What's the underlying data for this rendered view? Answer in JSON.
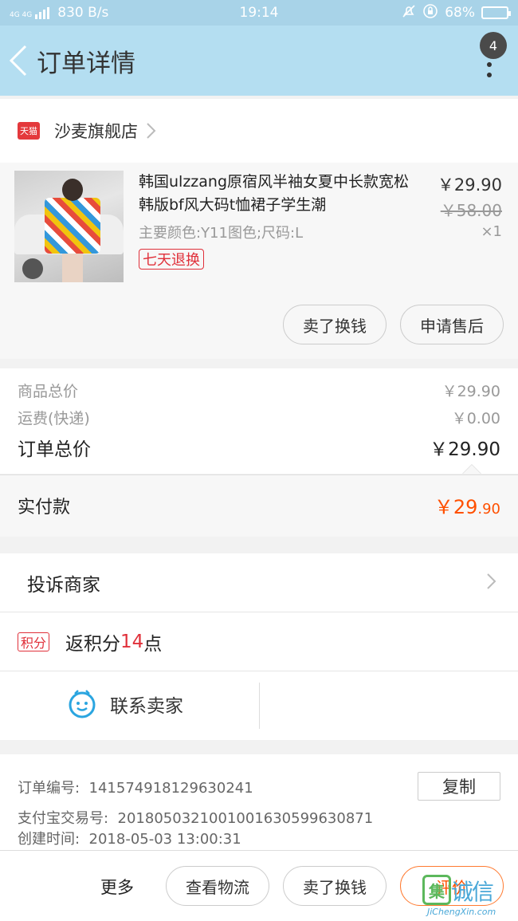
{
  "status_bar": {
    "network": "4G 4G",
    "speed": "830 B/s",
    "time": "19:14",
    "battery": "68%",
    "battery_fraction": 0.68
  },
  "nav": {
    "title": "订单详情",
    "badge": "4"
  },
  "shop": {
    "name": "沙麦旗舰店",
    "logo_text": "天猫"
  },
  "product": {
    "title": "韩国ulzzang原宿风半袖女夏中长款宽松韩版bf风大码t恤裙子学生潮",
    "spec": "主要颜色:Y11图色;尺码:L",
    "return_tag": "七天退换",
    "price": "￥29.90",
    "original_price": "￥58.00",
    "quantity": "×1",
    "buttons": {
      "sell": "卖了换钱",
      "after_sale": "申请售后"
    }
  },
  "totals": {
    "goods_label": "商品总价",
    "goods_value": "￥29.90",
    "shipping_label": "运费(快递)",
    "shipping_value": "￥0.00",
    "order_label": "订单总价",
    "order_value": "￥29.90"
  },
  "paid": {
    "label": "实付款",
    "currency": "￥",
    "int": "29",
    "dec": ".90"
  },
  "complain": {
    "label": "投诉商家"
  },
  "points": {
    "tag": "积分",
    "prefix": "返积分",
    "num": "14",
    "suffix": "点"
  },
  "contact": {
    "label": "联系卖家"
  },
  "order_info": {
    "order_no_label": "订单编号:",
    "order_no": "141574918129630241",
    "alipay_label": "支付宝交易号:",
    "alipay_no": "2018050321001001630599630871",
    "created_label": "创建时间:",
    "created": "2018-05-03 13:00:31",
    "copy_label": "复制"
  },
  "bottom": {
    "more": "更多",
    "logistics": "查看物流",
    "sell": "卖了换钱",
    "review": "评价"
  },
  "watermark": {
    "mark": "集",
    "text": "诚信",
    "url": "JiChengXin.com"
  },
  "colors": {
    "nav_bg": "#b4def1",
    "status_bg": "#a8d3e8",
    "price_accent": "#ff5000",
    "tag_red": "#e0303a"
  }
}
